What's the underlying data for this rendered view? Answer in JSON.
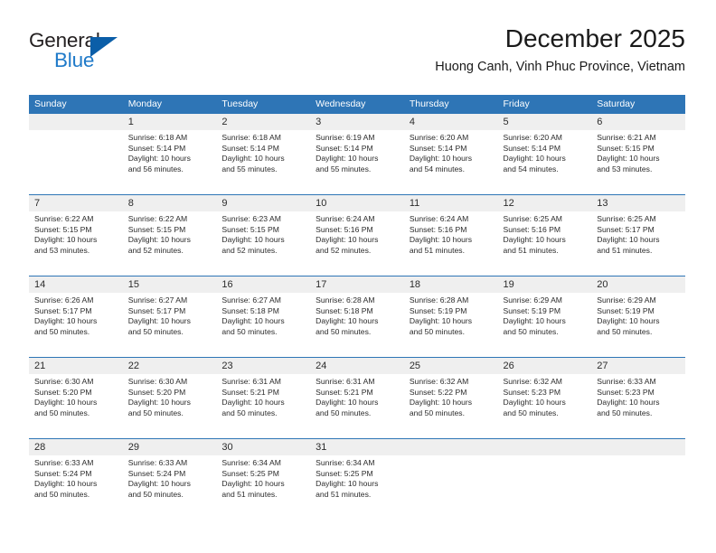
{
  "logo": {
    "word1": "General",
    "word2": "Blue",
    "icon": "triangle-logo-mark"
  },
  "header": {
    "title": "December 2025",
    "subtitle": "Huong Canh, Vinh Phuc Province, Vietnam"
  },
  "calendar": {
    "day_headers": [
      "Sunday",
      "Monday",
      "Tuesday",
      "Wednesday",
      "Thursday",
      "Friday",
      "Saturday"
    ],
    "accent_color": "#2e75b6",
    "number_row_color": "#efefef",
    "weeks": [
      {
        "numbers": [
          "",
          "1",
          "2",
          "3",
          "4",
          "5",
          "6"
        ],
        "cells": [
          {
            "empty": true,
            "sunrise": "",
            "sunset": "",
            "daylight_l1": "",
            "daylight_l2": ""
          },
          {
            "empty": false,
            "sunrise": "Sunrise: 6:18 AM",
            "sunset": "Sunset: 5:14 PM",
            "daylight_l1": "Daylight: 10 hours",
            "daylight_l2": "and 56 minutes."
          },
          {
            "empty": false,
            "sunrise": "Sunrise: 6:18 AM",
            "sunset": "Sunset: 5:14 PM",
            "daylight_l1": "Daylight: 10 hours",
            "daylight_l2": "and 55 minutes."
          },
          {
            "empty": false,
            "sunrise": "Sunrise: 6:19 AM",
            "sunset": "Sunset: 5:14 PM",
            "daylight_l1": "Daylight: 10 hours",
            "daylight_l2": "and 55 minutes."
          },
          {
            "empty": false,
            "sunrise": "Sunrise: 6:20 AM",
            "sunset": "Sunset: 5:14 PM",
            "daylight_l1": "Daylight: 10 hours",
            "daylight_l2": "and 54 minutes."
          },
          {
            "empty": false,
            "sunrise": "Sunrise: 6:20 AM",
            "sunset": "Sunset: 5:14 PM",
            "daylight_l1": "Daylight: 10 hours",
            "daylight_l2": "and 54 minutes."
          },
          {
            "empty": false,
            "sunrise": "Sunrise: 6:21 AM",
            "sunset": "Sunset: 5:15 PM",
            "daylight_l1": "Daylight: 10 hours",
            "daylight_l2": "and 53 minutes."
          }
        ]
      },
      {
        "numbers": [
          "7",
          "8",
          "9",
          "10",
          "11",
          "12",
          "13"
        ],
        "cells": [
          {
            "empty": false,
            "sunrise": "Sunrise: 6:22 AM",
            "sunset": "Sunset: 5:15 PM",
            "daylight_l1": "Daylight: 10 hours",
            "daylight_l2": "and 53 minutes."
          },
          {
            "empty": false,
            "sunrise": "Sunrise: 6:22 AM",
            "sunset": "Sunset: 5:15 PM",
            "daylight_l1": "Daylight: 10 hours",
            "daylight_l2": "and 52 minutes."
          },
          {
            "empty": false,
            "sunrise": "Sunrise: 6:23 AM",
            "sunset": "Sunset: 5:15 PM",
            "daylight_l1": "Daylight: 10 hours",
            "daylight_l2": "and 52 minutes."
          },
          {
            "empty": false,
            "sunrise": "Sunrise: 6:24 AM",
            "sunset": "Sunset: 5:16 PM",
            "daylight_l1": "Daylight: 10 hours",
            "daylight_l2": "and 52 minutes."
          },
          {
            "empty": false,
            "sunrise": "Sunrise: 6:24 AM",
            "sunset": "Sunset: 5:16 PM",
            "daylight_l1": "Daylight: 10 hours",
            "daylight_l2": "and 51 minutes."
          },
          {
            "empty": false,
            "sunrise": "Sunrise: 6:25 AM",
            "sunset": "Sunset: 5:16 PM",
            "daylight_l1": "Daylight: 10 hours",
            "daylight_l2": "and 51 minutes."
          },
          {
            "empty": false,
            "sunrise": "Sunrise: 6:25 AM",
            "sunset": "Sunset: 5:17 PM",
            "daylight_l1": "Daylight: 10 hours",
            "daylight_l2": "and 51 minutes."
          }
        ]
      },
      {
        "numbers": [
          "14",
          "15",
          "16",
          "17",
          "18",
          "19",
          "20"
        ],
        "cells": [
          {
            "empty": false,
            "sunrise": "Sunrise: 6:26 AM",
            "sunset": "Sunset: 5:17 PM",
            "daylight_l1": "Daylight: 10 hours",
            "daylight_l2": "and 50 minutes."
          },
          {
            "empty": false,
            "sunrise": "Sunrise: 6:27 AM",
            "sunset": "Sunset: 5:17 PM",
            "daylight_l1": "Daylight: 10 hours",
            "daylight_l2": "and 50 minutes."
          },
          {
            "empty": false,
            "sunrise": "Sunrise: 6:27 AM",
            "sunset": "Sunset: 5:18 PM",
            "daylight_l1": "Daylight: 10 hours",
            "daylight_l2": "and 50 minutes."
          },
          {
            "empty": false,
            "sunrise": "Sunrise: 6:28 AM",
            "sunset": "Sunset: 5:18 PM",
            "daylight_l1": "Daylight: 10 hours",
            "daylight_l2": "and 50 minutes."
          },
          {
            "empty": false,
            "sunrise": "Sunrise: 6:28 AM",
            "sunset": "Sunset: 5:19 PM",
            "daylight_l1": "Daylight: 10 hours",
            "daylight_l2": "and 50 minutes."
          },
          {
            "empty": false,
            "sunrise": "Sunrise: 6:29 AM",
            "sunset": "Sunset: 5:19 PM",
            "daylight_l1": "Daylight: 10 hours",
            "daylight_l2": "and 50 minutes."
          },
          {
            "empty": false,
            "sunrise": "Sunrise: 6:29 AM",
            "sunset": "Sunset: 5:19 PM",
            "daylight_l1": "Daylight: 10 hours",
            "daylight_l2": "and 50 minutes."
          }
        ]
      },
      {
        "numbers": [
          "21",
          "22",
          "23",
          "24",
          "25",
          "26",
          "27"
        ],
        "cells": [
          {
            "empty": false,
            "sunrise": "Sunrise: 6:30 AM",
            "sunset": "Sunset: 5:20 PM",
            "daylight_l1": "Daylight: 10 hours",
            "daylight_l2": "and 50 minutes."
          },
          {
            "empty": false,
            "sunrise": "Sunrise: 6:30 AM",
            "sunset": "Sunset: 5:20 PM",
            "daylight_l1": "Daylight: 10 hours",
            "daylight_l2": "and 50 minutes."
          },
          {
            "empty": false,
            "sunrise": "Sunrise: 6:31 AM",
            "sunset": "Sunset: 5:21 PM",
            "daylight_l1": "Daylight: 10 hours",
            "daylight_l2": "and 50 minutes."
          },
          {
            "empty": false,
            "sunrise": "Sunrise: 6:31 AM",
            "sunset": "Sunset: 5:21 PM",
            "daylight_l1": "Daylight: 10 hours",
            "daylight_l2": "and 50 minutes."
          },
          {
            "empty": false,
            "sunrise": "Sunrise: 6:32 AM",
            "sunset": "Sunset: 5:22 PM",
            "daylight_l1": "Daylight: 10 hours",
            "daylight_l2": "and 50 minutes."
          },
          {
            "empty": false,
            "sunrise": "Sunrise: 6:32 AM",
            "sunset": "Sunset: 5:23 PM",
            "daylight_l1": "Daylight: 10 hours",
            "daylight_l2": "and 50 minutes."
          },
          {
            "empty": false,
            "sunrise": "Sunrise: 6:33 AM",
            "sunset": "Sunset: 5:23 PM",
            "daylight_l1": "Daylight: 10 hours",
            "daylight_l2": "and 50 minutes."
          }
        ]
      },
      {
        "numbers": [
          "28",
          "29",
          "30",
          "31",
          "",
          "",
          ""
        ],
        "cells": [
          {
            "empty": false,
            "sunrise": "Sunrise: 6:33 AM",
            "sunset": "Sunset: 5:24 PM",
            "daylight_l1": "Daylight: 10 hours",
            "daylight_l2": "and 50 minutes."
          },
          {
            "empty": false,
            "sunrise": "Sunrise: 6:33 AM",
            "sunset": "Sunset: 5:24 PM",
            "daylight_l1": "Daylight: 10 hours",
            "daylight_l2": "and 50 minutes."
          },
          {
            "empty": false,
            "sunrise": "Sunrise: 6:34 AM",
            "sunset": "Sunset: 5:25 PM",
            "daylight_l1": "Daylight: 10 hours",
            "daylight_l2": "and 51 minutes."
          },
          {
            "empty": false,
            "sunrise": "Sunrise: 6:34 AM",
            "sunset": "Sunset: 5:25 PM",
            "daylight_l1": "Daylight: 10 hours",
            "daylight_l2": "and 51 minutes."
          },
          {
            "empty": true,
            "sunrise": "",
            "sunset": "",
            "daylight_l1": "",
            "daylight_l2": ""
          },
          {
            "empty": true,
            "sunrise": "",
            "sunset": "",
            "daylight_l1": "",
            "daylight_l2": ""
          },
          {
            "empty": true,
            "sunrise": "",
            "sunset": "",
            "daylight_l1": "",
            "daylight_l2": ""
          }
        ]
      }
    ]
  }
}
